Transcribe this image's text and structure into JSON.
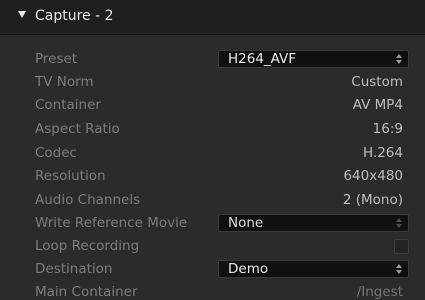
{
  "header": {
    "title": "Capture - 2"
  },
  "rows": {
    "preset": {
      "label": "Preset",
      "value": "H264_AVF"
    },
    "tv_norm": {
      "label": "TV Norm",
      "value": "Custom"
    },
    "container": {
      "label": "Container",
      "value": "AV MP4"
    },
    "aspect_ratio": {
      "label": "Aspect Ratio",
      "value": "16:9"
    },
    "codec": {
      "label": "Codec",
      "value": "H.264"
    },
    "resolution": {
      "label": "Resolution",
      "value": "640x480"
    },
    "audio_channels": {
      "label": "Audio Channels",
      "value": "2 (Mono)"
    },
    "write_reference_movie": {
      "label": "Write Reference Movie",
      "value": "None"
    },
    "loop_recording": {
      "label": "Loop Recording",
      "checked": false
    },
    "destination": {
      "label": "Destination",
      "value": "Demo"
    },
    "main_container": {
      "label": "Main Container",
      "value": "/Ingest"
    }
  },
  "colors": {
    "background": "#2b2b2b",
    "header_background": "#1f1f1f",
    "label_text": "#7d7d7d",
    "value_text": "#bdbdbd",
    "popup_background": "#101010"
  },
  "icons": {
    "disclosure": "disclosure-triangle-icon",
    "popup_arrows": "up-down-arrows-icon"
  }
}
